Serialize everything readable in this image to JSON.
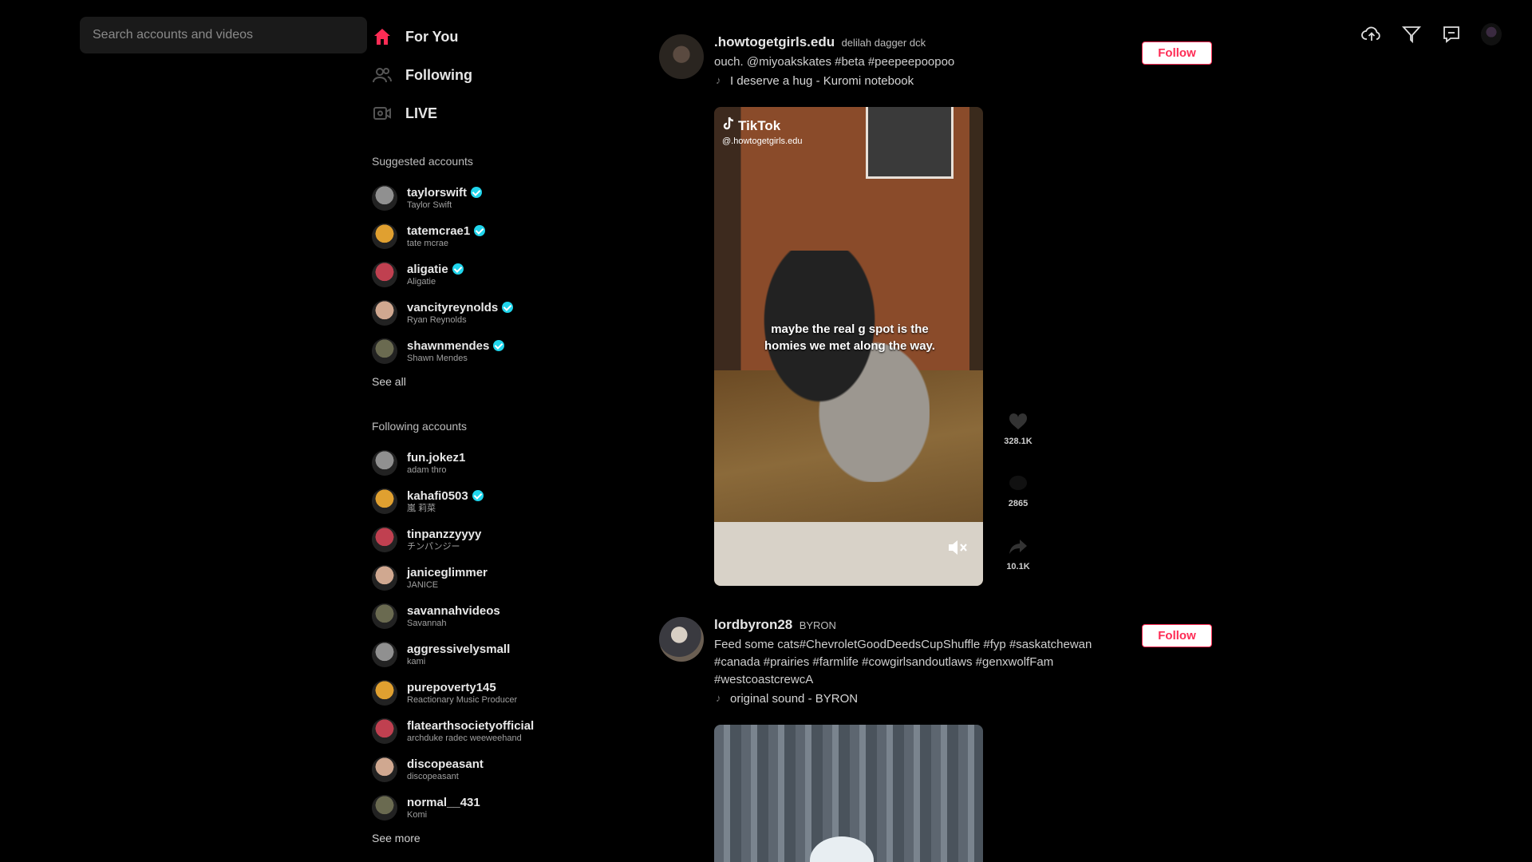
{
  "search": {
    "placeholder": "Search accounts and videos"
  },
  "nav": [
    {
      "label": "For You",
      "icon": "home-icon"
    },
    {
      "label": "Following",
      "icon": "people-icon"
    },
    {
      "label": "LIVE",
      "icon": "live-icon"
    }
  ],
  "suggested": {
    "title": "Suggested accounts",
    "see_all": "See all",
    "accounts": [
      {
        "username": "taylorswift",
        "display": "Taylor Swift",
        "verified": true
      },
      {
        "username": "tatemcrae1",
        "display": "tate mcrae",
        "verified": true
      },
      {
        "username": "aligatie",
        "display": "Aligatie",
        "verified": true
      },
      {
        "username": "vancityreynolds",
        "display": "Ryan Reynolds",
        "verified": true
      },
      {
        "username": "shawnmendes",
        "display": "Shawn Mendes",
        "verified": true
      }
    ]
  },
  "following": {
    "title": "Following accounts",
    "see_more": "See more",
    "accounts": [
      {
        "username": "fun.jokez1",
        "display": "adam thro",
        "verified": false
      },
      {
        "username": "kahafi0503",
        "display": "嵐 莉菜",
        "verified": true
      },
      {
        "username": "tinpanzzyyyy",
        "display": "チンパンジー",
        "verified": false
      },
      {
        "username": "janiceglimmer",
        "display": "JANICE",
        "verified": false
      },
      {
        "username": "savannahvideos",
        "display": "Savannah",
        "verified": false
      },
      {
        "username": "aggressivelysmall",
        "display": "kami",
        "verified": false
      },
      {
        "username": "purepoverty145",
        "display": "Reactionary Music Producer",
        "verified": false
      },
      {
        "username": "flatearthsocietyofficial",
        "display": "archduke radec weeweehand",
        "verified": false
      },
      {
        "username": "discopeasant",
        "display": "discopeasant",
        "verified": false
      },
      {
        "username": "normal__431",
        "display": "Komi",
        "verified": false
      }
    ]
  },
  "posts": [
    {
      "author": ".howtogetgirls.edu",
      "nickname": "delilah dagger dck",
      "caption": "ouch. @miyoakskates #beta #peepeepoopoo",
      "sound": "I deserve a hug - Kuromi notebook",
      "follow_label": "Follow",
      "watermark_title": "TikTok",
      "watermark_handle": "@.howtogetgirls.edu",
      "overlay_text": "maybe the real g spot is the homies we met along the way.",
      "likes": "328.1K",
      "comments": "2865",
      "shares": "10.1K"
    },
    {
      "author": "lordbyron28",
      "nickname": "BYRON",
      "caption": "Feed some cats#ChevroletGoodDeedsCupShuffle #fyp #saskatchewan #canada #prairies #farmlife #cowgirlsandoutlaws #genxwolfFam #westcoastcrewcA",
      "sound": "original sound - BYRON",
      "follow_label": "Follow"
    }
  ],
  "colors": {
    "accent": "#fe2c55",
    "verified": "#20d5ec",
    "background": "#000000"
  }
}
